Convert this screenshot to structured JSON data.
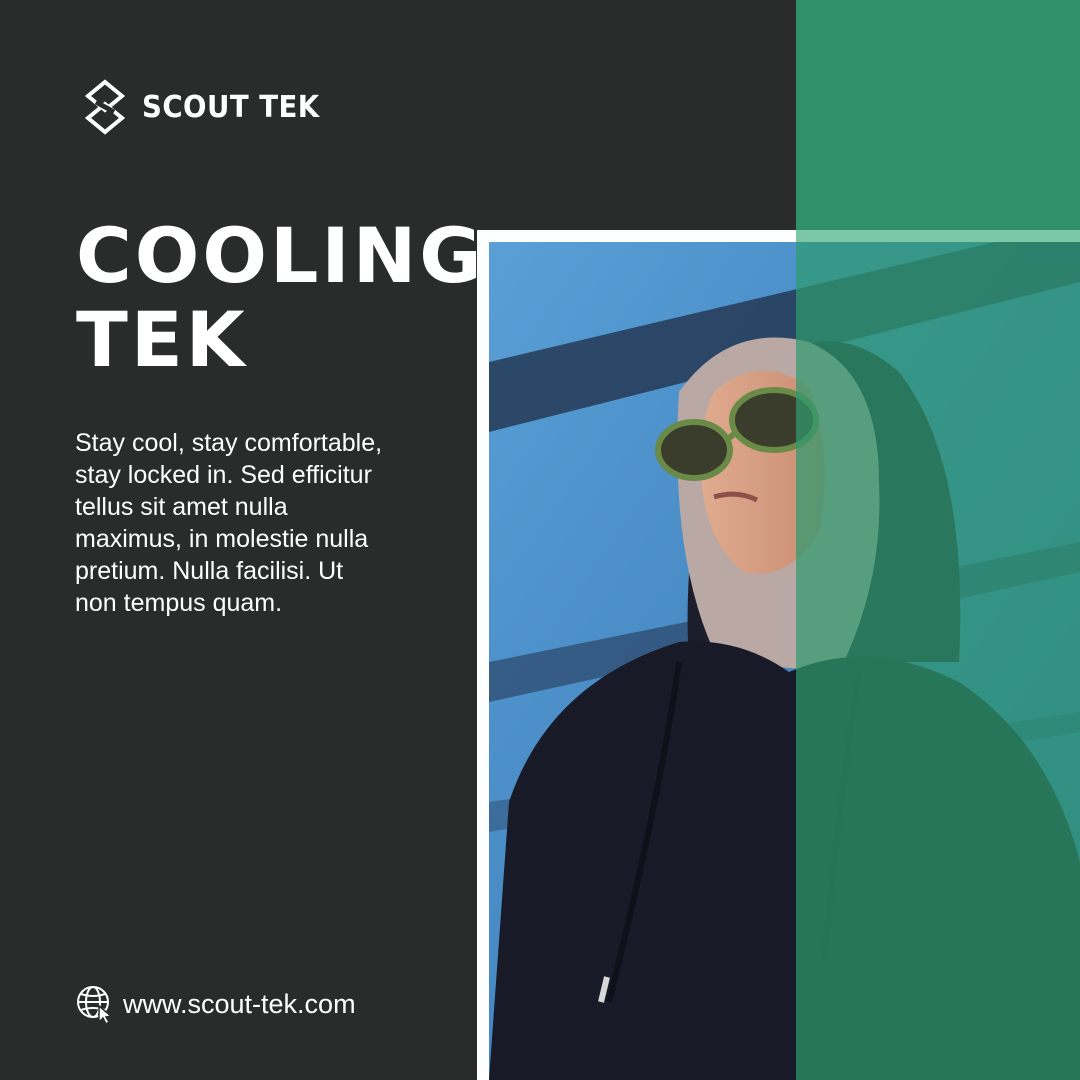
{
  "brand": {
    "logo_icon": "scout-tek-logo-icon",
    "name": "SCOUT TEK"
  },
  "headline": {
    "line1": "COOLING",
    "line2": "TEK"
  },
  "body_text": "Stay cool, stay comfortable, stay locked in. Sed efficitur tellus sit amet nulla maximus, in molestie nulla pretium. Nulla facilisi. Ut non tempus quam.",
  "footer": {
    "icon": "globe-cursor-icon",
    "website": "www.scout-tek.com"
  },
  "colors": {
    "background": "#2a2b2b",
    "accent_green": "#33775c",
    "overlay_green": "#2f9a6f",
    "text": "#ffffff"
  }
}
